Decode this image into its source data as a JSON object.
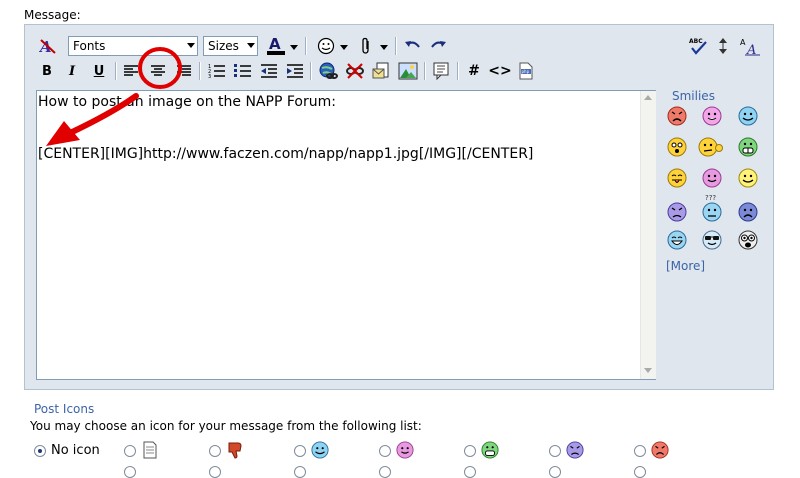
{
  "message_label": "Message:",
  "toolbar": {
    "font_select": "Fonts",
    "size_select": "Sizes",
    "bold": "B",
    "italic": "I",
    "underline": "U",
    "hash": "#",
    "code": "<>"
  },
  "editor": {
    "line1": "How to post an image on the NAPP Forum:",
    "line2": "[CENTER][IMG]http://www.faczen.com/napp/napp1.jpg[/IMG][/CENTER]"
  },
  "smilies": {
    "title": "Smilies",
    "more": "[More]"
  },
  "post_icons": {
    "title": "Post Icons",
    "description": "You may choose an icon for your message from the following list:",
    "no_icon_label": "No icon"
  },
  "colors": {
    "panel_bg": "#dfe6ee",
    "link": "#3c64a8",
    "annotation_red": "#e00000"
  }
}
